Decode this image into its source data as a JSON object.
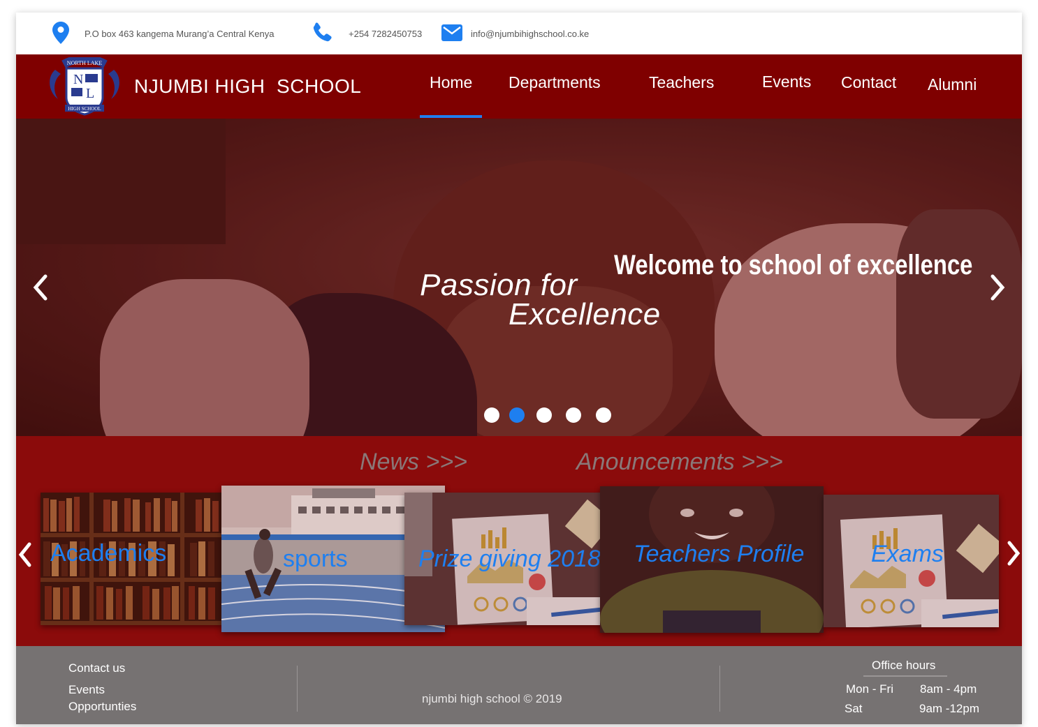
{
  "topbar": {
    "address": "P.O box 463 kangema Murang’a Central Kenya",
    "phone": "+254 7282450753",
    "email": "info@njumbihighschool.co.ke"
  },
  "header": {
    "logo_text_top": "NORTH LAKE",
    "logo_text_bottom": "HIGH SCHOOL",
    "school_name": "NJUMBI HIGH  SCHOOL",
    "nav": [
      "Home",
      "Departments",
      "Teachers",
      "Events",
      "Contact",
      "Alumni"
    ],
    "active_nav": "Home"
  },
  "hero": {
    "tagline_line1": "Passion for",
    "tagline_line2": "Excellence",
    "welcome": "Welcome to school of excellence",
    "slide_count": 5,
    "active_slide": 2
  },
  "band": {
    "news_link": "News >>>",
    "announcements_link": "Anouncements >>>",
    "cards": [
      "Academics",
      "sports",
      "Prize giving 2018",
      "Teachers Profile",
      "Exams"
    ]
  },
  "footer": {
    "links": [
      "Contact us",
      "Events",
      "Opportunties"
    ],
    "copyright": "njumbi high school © 2019",
    "hours_title": "Office hours",
    "hours": [
      {
        "days": "Mon - Fri",
        "time": "8am - 4pm"
      },
      {
        "days": "Sat",
        "time": "9am -12pm"
      }
    ]
  },
  "colors": {
    "header_bg": "#7f0000",
    "band_bg": "#8b0b0b",
    "footer_bg": "#767272",
    "accent": "#1e7ff0"
  }
}
